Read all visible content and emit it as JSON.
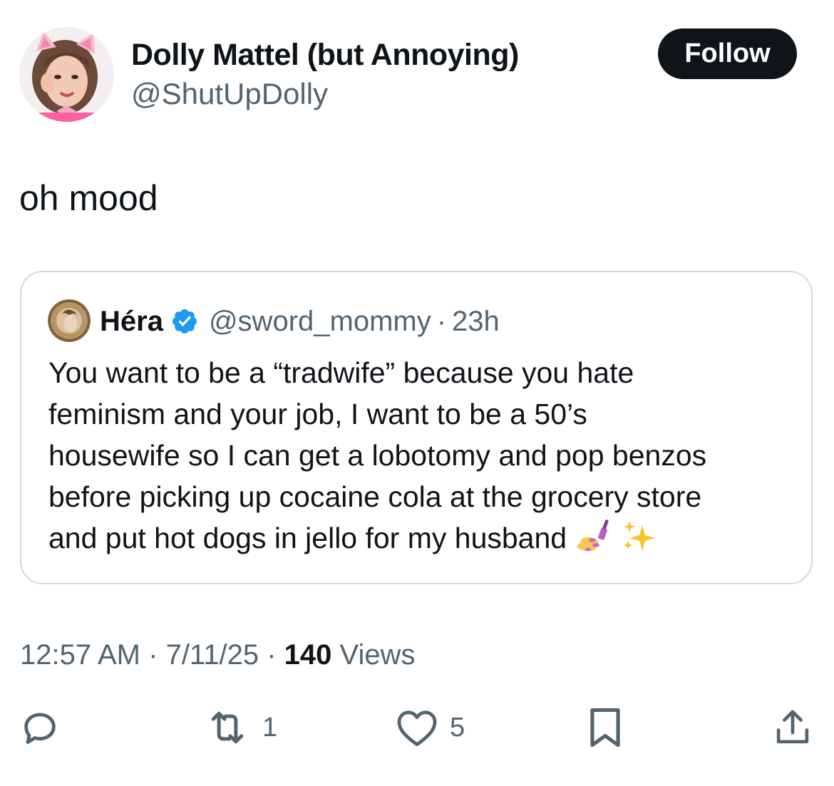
{
  "author": {
    "display_name": "Dolly Mattel (but Annoying)",
    "handle": "@ShutUpDolly"
  },
  "follow_label": "Follow",
  "tweet_text": "oh mood",
  "quoted": {
    "display_name": "Héra",
    "handle": "@sword_mommy",
    "separator": "·",
    "time": "23h",
    "verified": true,
    "text_lines": [
      "You want to be a “tradwife” because you hate",
      "feminism and your job, I want to be a 50’s",
      "housewife so I can get a lobotomy and pop benzos",
      "before picking up cocaine cola at the grocery store",
      "and put hot dogs in jello for my husband"
    ],
    "emoji": [
      "nail-polish",
      "sparkles"
    ]
  },
  "meta": {
    "time": "12:57 AM",
    "separator": "·",
    "date": "7/11/25",
    "views_count": "140",
    "views_label": "Views"
  },
  "actions": {
    "reply_count": "",
    "retweet_count": "1",
    "like_count": "5"
  },
  "colors": {
    "text": "#0f1419",
    "secondary": "#536471",
    "border": "#cfd9de",
    "verified": "#1d9bf0",
    "follow_bg": "#0f1419"
  }
}
